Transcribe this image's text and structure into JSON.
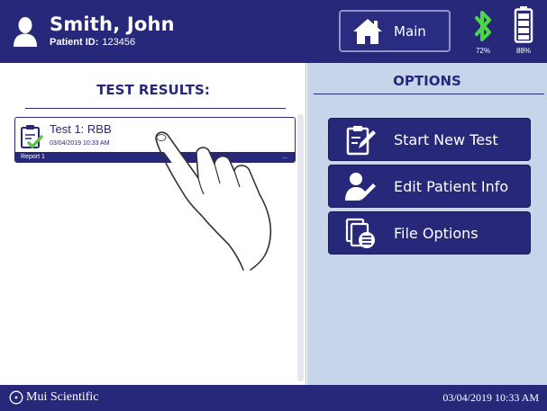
{
  "header": {
    "patient_name": "Smith, John",
    "patient_id_label": "Patient ID:",
    "patient_id": "123456",
    "main_button_label": "Main",
    "bluetooth_percent": "72%",
    "battery_percent": "88%",
    "icons": [
      "user-icon",
      "home-icon",
      "bluetooth-icon",
      "battery-icon"
    ]
  },
  "results": {
    "title": "TEST RESULTS:",
    "items": [
      {
        "name": "Test 1: RBB",
        "date": "03/04/2019 10:33 AM",
        "report_label": "Report 1",
        "more": "..."
      }
    ]
  },
  "options": {
    "title": "OPTIONS",
    "buttons": [
      {
        "label": "Start New Test",
        "icon": "edit-document-icon"
      },
      {
        "label": "Edit Patient Info",
        "icon": "edit-patient-icon"
      },
      {
        "label": "File Options",
        "icon": "file-list-icon"
      }
    ]
  },
  "footer": {
    "brand": "Mui Scientific",
    "datetime": "03/04/2019 10:33 AM"
  },
  "colors": {
    "primary": "#27287a",
    "options_bg": "#c7d5ea",
    "bluetooth": "#4ad84a"
  }
}
